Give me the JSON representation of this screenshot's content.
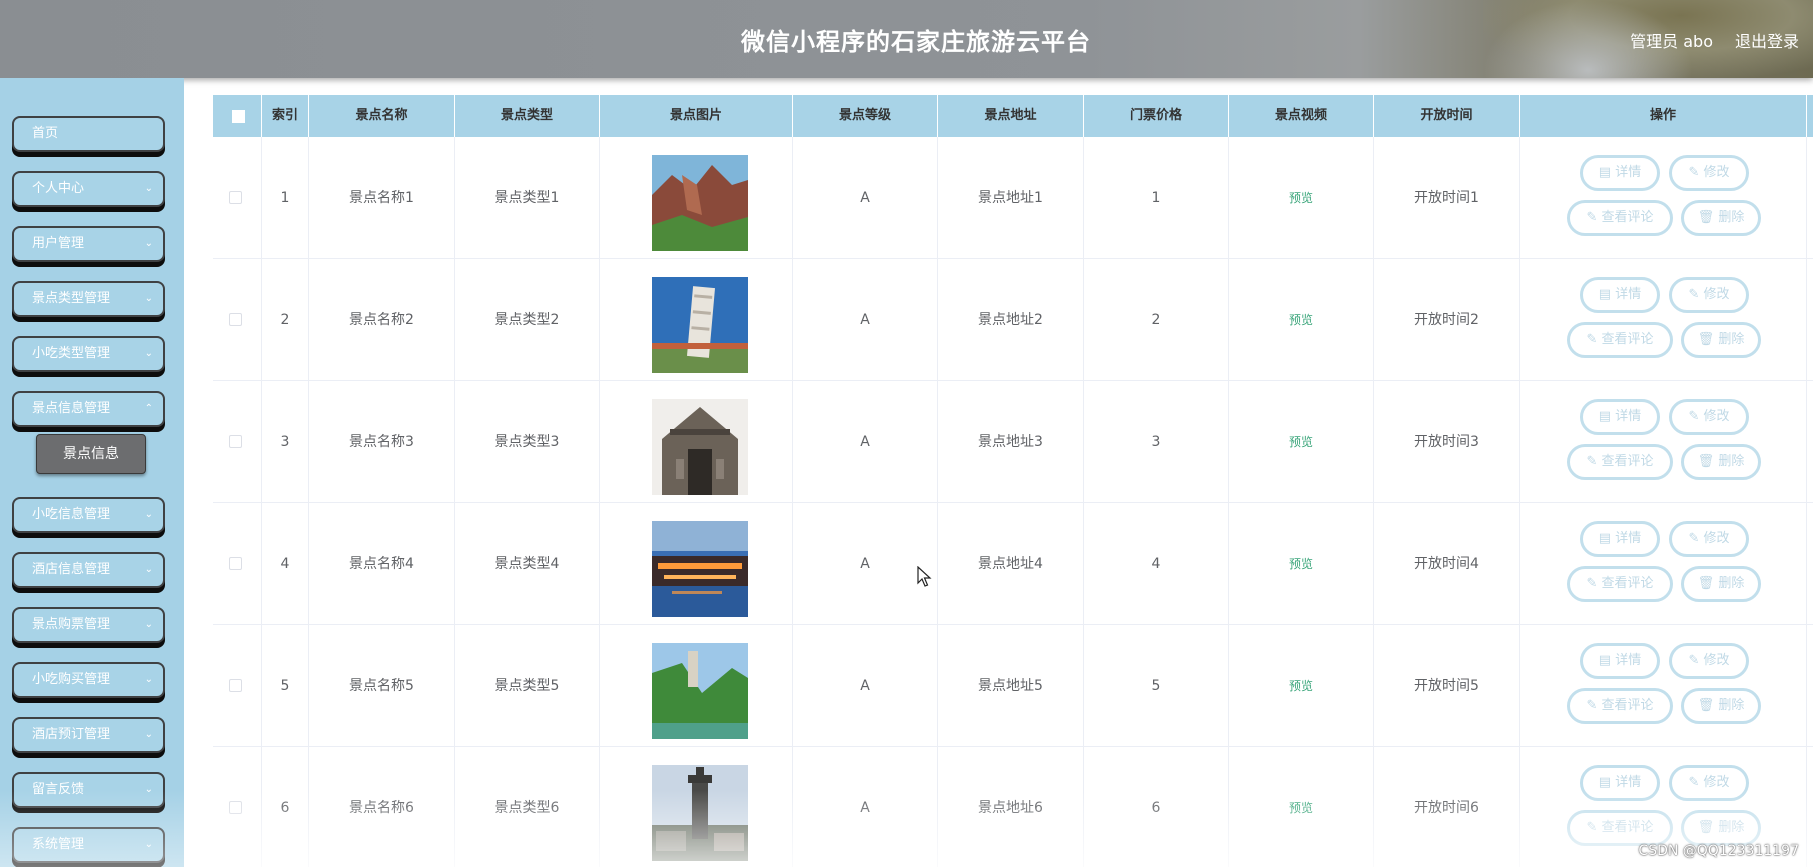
{
  "header": {
    "title": "微信小程序的石家庄旅游云平台",
    "admin": "管理员 abo",
    "logout": "退出登录"
  },
  "sidebar": {
    "items": [
      {
        "label": "首页"
      },
      {
        "label": "个人中心"
      },
      {
        "label": "用户管理"
      },
      {
        "label": "景点类型管理"
      },
      {
        "label": "小吃类型管理"
      },
      {
        "label": "景点信息管理"
      },
      {
        "label": "小吃信息管理"
      },
      {
        "label": "酒店信息管理"
      },
      {
        "label": "景点购票管理"
      },
      {
        "label": "小吃购买管理"
      },
      {
        "label": "酒店预订管理"
      },
      {
        "label": "留言反馈"
      },
      {
        "label": "系统管理"
      }
    ],
    "submenu_label": "景点信息"
  },
  "table": {
    "headers": [
      "索引",
      "景点名称",
      "景点类型",
      "景点图片",
      "景点等级",
      "景点地址",
      "门票价格",
      "景点视频",
      "开放时间",
      "操作"
    ],
    "rows": [
      {
        "index": "1",
        "name": "景点名称1",
        "type": "景点类型1",
        "level": "A",
        "address": "景点地址1",
        "price": "1",
        "video": "预览",
        "open_time": "开放时间1"
      },
      {
        "index": "2",
        "name": "景点名称2",
        "type": "景点类型2",
        "level": "A",
        "address": "景点地址2",
        "price": "2",
        "video": "预览",
        "open_time": "开放时间2"
      },
      {
        "index": "3",
        "name": "景点名称3",
        "type": "景点类型3",
        "level": "A",
        "address": "景点地址3",
        "price": "3",
        "video": "预览",
        "open_time": "开放时间3"
      },
      {
        "index": "4",
        "name": "景点名称4",
        "type": "景点类型4",
        "level": "A",
        "address": "景点地址4",
        "price": "4",
        "video": "预览",
        "open_time": "开放时间4"
      },
      {
        "index": "5",
        "name": "景点名称5",
        "type": "景点类型5",
        "level": "A",
        "address": "景点地址5",
        "price": "5",
        "video": "预览",
        "open_time": "开放时间5"
      },
      {
        "index": "6",
        "name": "景点名称6",
        "type": "景点类型6",
        "level": "A",
        "address": "景点地址6",
        "price": "6",
        "video": "预览",
        "open_time": "开放时间6"
      }
    ],
    "actions": {
      "detail": "详情",
      "edit": "修改",
      "comments": "查看评论",
      "delete": "删除"
    }
  },
  "watermark": "CSDN @QQ123311197",
  "colors": {
    "sidebar_bg": "#a5d1e6",
    "table_header_bg": "#a8d3e7",
    "preview_link": "#3aa57a"
  }
}
